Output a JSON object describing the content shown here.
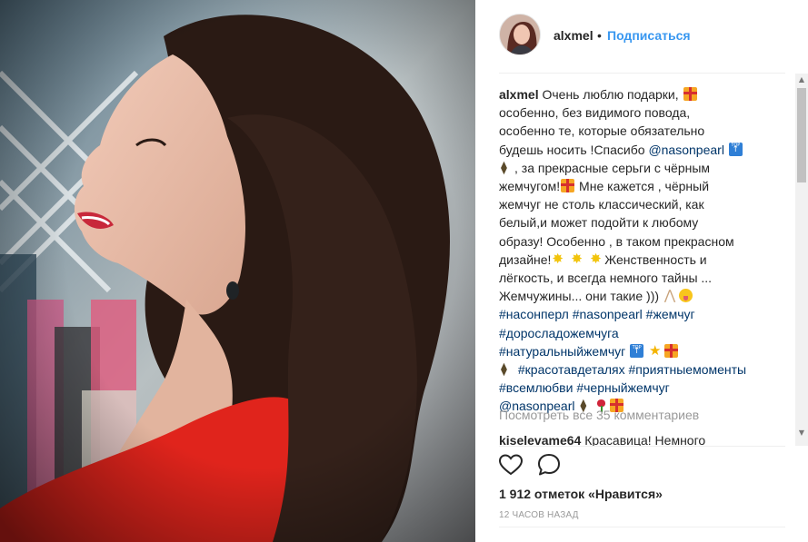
{
  "header": {
    "username": "alxmel",
    "separator": "•",
    "follow_label": "Подписаться"
  },
  "caption": {
    "username": "alxmel",
    "lines": [
      [
        "Очень люблю подарки, ",
        {
          "emoji": "gift"
        }
      ],
      [
        "особенно, без видимого повода,"
      ],
      [
        "особенно те, которые обязательно"
      ],
      [
        "будешь носить !Спасибо ",
        {
          "tag": "@nasonpearl"
        },
        " ",
        {
          "emoji": "top"
        }
      ],
      [
        {
          "emoji": "hang"
        },
        ", за прекрасные серьги с чёрным"
      ],
      [
        "жемчугом!",
        {
          "emoji": "gift"
        },
        " Мне кажется , чёрный"
      ],
      [
        "жемчуг не столь классический, как"
      ],
      [
        "белый,и может подойти к любому"
      ],
      [
        "образу! Особенно , в таком прекрасном"
      ],
      [
        "дизайне!",
        {
          "emoji": "sparkle"
        },
        " ",
        {
          "emoji": "sparkle"
        },
        " ",
        {
          "emoji": "sparkle"
        },
        "Женственность и"
      ],
      [
        "лёгкость, и всегда немного тайны ..."
      ],
      [
        "Жемчужины... они такие ))) ",
        {
          "emoji": "pray"
        },
        {
          "emoji": "tongue"
        }
      ],
      [
        {
          "tag": "#насонперл"
        },
        " ",
        {
          "tag": "#nasonpearl"
        },
        " ",
        {
          "tag": "#жемчуг"
        }
      ],
      [
        {
          "tag": "#доросладожемчуга"
        }
      ],
      [
        {
          "tag": "#натуральныйжемчуг"
        },
        " ",
        {
          "emoji": "top"
        },
        " ",
        {
          "emoji": "star"
        },
        {
          "emoji": "gift"
        }
      ],
      [
        {
          "emoji": "hang"
        },
        " ",
        {
          "tag": "#красотавдеталях"
        },
        " ",
        {
          "tag": "#приятныемоменты"
        }
      ],
      [
        {
          "tag": "#всемлюбви"
        },
        " ",
        {
          "tag": "#черныйжемчуг"
        }
      ],
      [
        {
          "tag": "@nasonpearl"
        },
        " ",
        {
          "emoji": "hang"
        },
        {
          "emoji": "rose"
        },
        {
          "emoji": "gift"
        }
      ]
    ]
  },
  "view_all_comments": "Посмотреть все 35 комментариев",
  "comment2": {
    "username": "kiselevame64",
    "text": "Красавица! Немного"
  },
  "likes_text": "1 912 отметок «Нравится»",
  "time_text": "12 ЧАСОВ НАЗАД",
  "icons": {
    "like": "heart-outline-icon",
    "comment": "speech-bubble-icon"
  },
  "colors": {
    "follow_blue": "#3897f0",
    "tag_blue": "#003569",
    "meta_gray": "#999999",
    "dress_red": "#e0241c"
  }
}
